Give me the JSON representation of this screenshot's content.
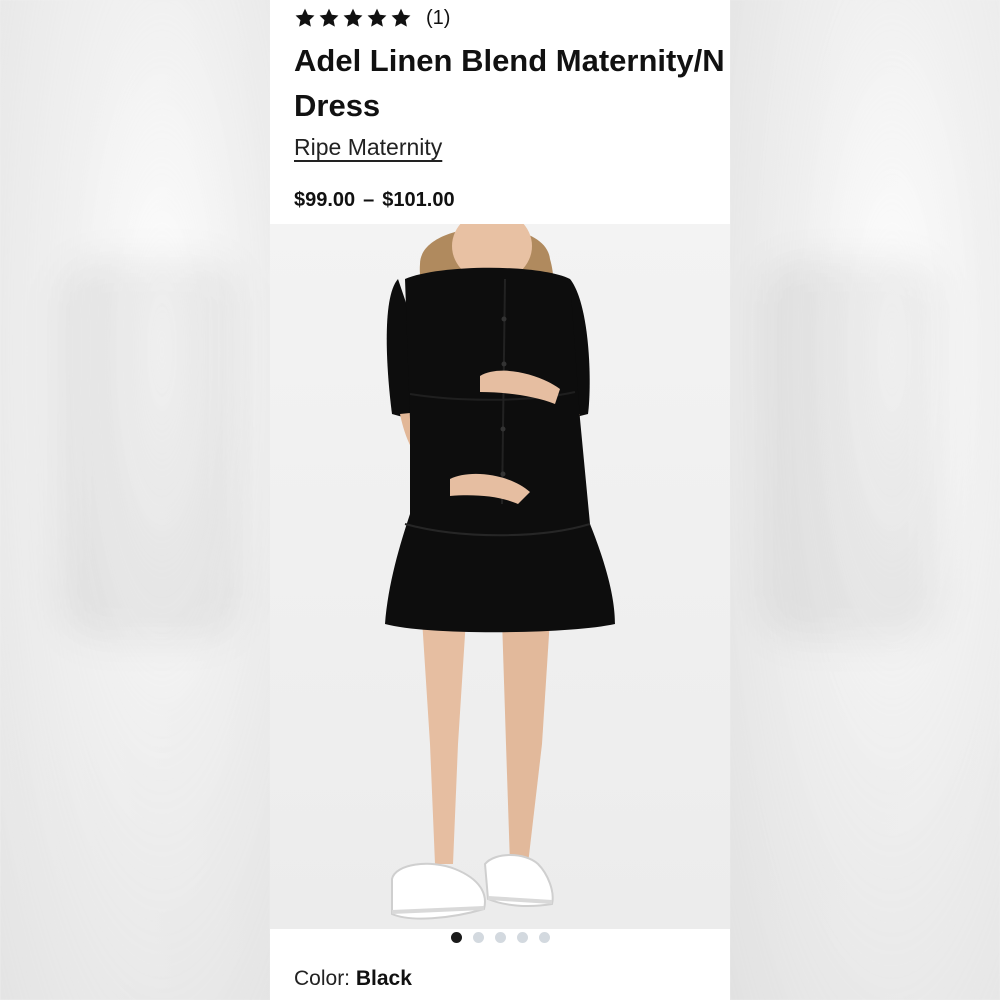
{
  "product": {
    "rating_stars": 5,
    "rating_count": "(1)",
    "title_line1": "Adel Linen Blend Maternity/N",
    "title_line2": "Dress",
    "brand": "Ripe Maternity",
    "price_low": "$99.00",
    "price_sep": "–",
    "price_high": "$101.00"
  },
  "gallery": {
    "total_images": 5,
    "active_index": 0
  },
  "color": {
    "label": "Color:",
    "value": "Black"
  },
  "icons": {
    "rating": "star-icon"
  },
  "colors": {
    "text": "#111111",
    "dot_active": "#1a1a1a",
    "dot_inactive": "#d3d9df",
    "dress": "#0d0d0d"
  }
}
